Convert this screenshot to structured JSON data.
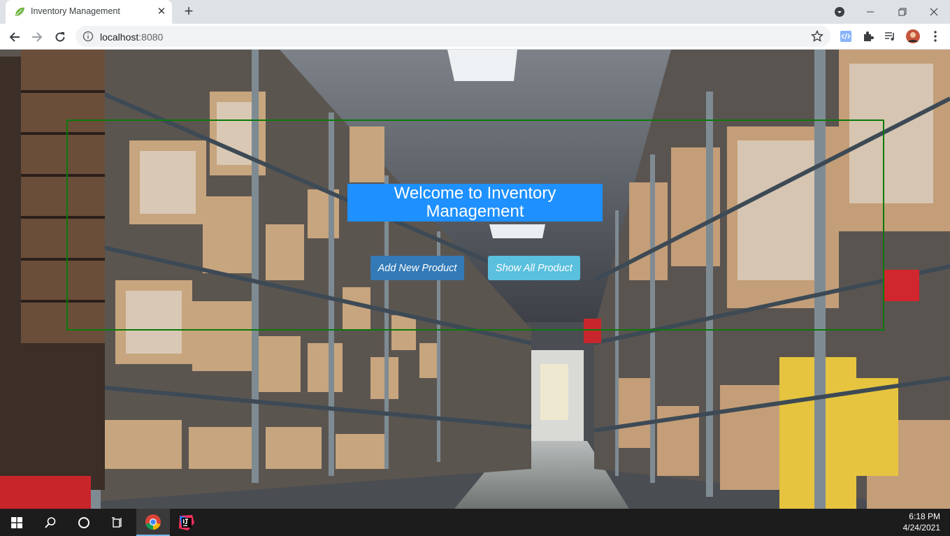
{
  "browser": {
    "tab_title": "Inventory Management",
    "tab_close": "✕",
    "new_tab": "+",
    "url_host": "localhost",
    "url_port": ":8080"
  },
  "page": {
    "welcome_title": "Welcome to Inventory Management",
    "add_button": "Add New Product",
    "show_button": "Show All Product",
    "colors": {
      "title_bg": "#1e90ff",
      "add_bg": "#337ab7",
      "show_bg": "#5bc0de",
      "frame_border": "#0a7a0a"
    }
  },
  "icons": [
    "spring-leaf-icon",
    "back-icon",
    "forward-icon",
    "reload-icon",
    "info-icon",
    "star-icon",
    "code-icon",
    "puzzle-icon",
    "media-queue-icon",
    "avatar",
    "kebab-menu-icon",
    "windows-start-icon",
    "search-icon",
    "cortana-icon",
    "task-view-icon",
    "chrome-icon",
    "intellij-icon"
  ],
  "taskbar": {
    "time": "6:18 PM",
    "date": "4/24/2021"
  }
}
